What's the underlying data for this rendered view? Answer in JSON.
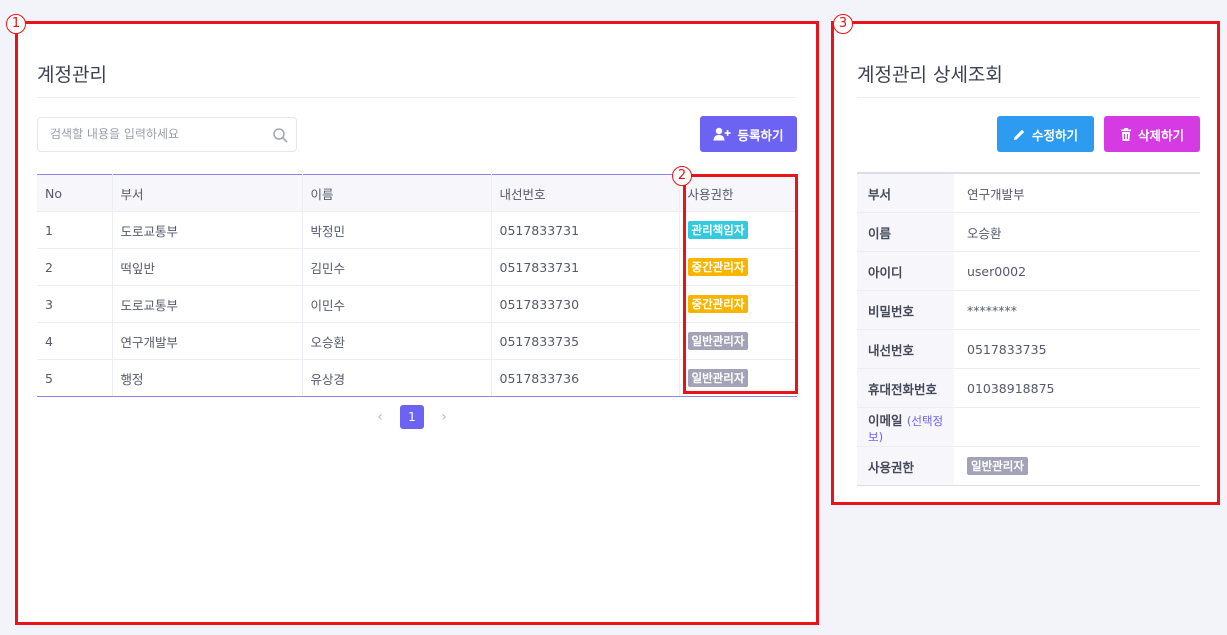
{
  "list_panel": {
    "title": "계정관리",
    "search": {
      "placeholder": "검색할 내용을 입력하세요"
    },
    "register_button": "등록하기",
    "columns": [
      "No",
      "부서",
      "이름",
      "내선번호",
      "사용권한"
    ],
    "rows": [
      {
        "no": "1",
        "dept": "도로교통부",
        "name": "박정민",
        "ext": "0517833731",
        "role": "관리책임자",
        "role_color": "#34c9dd"
      },
      {
        "no": "2",
        "dept": "떡잎반",
        "name": "김민수",
        "ext": "0517833731",
        "role": "중간관리자",
        "role_color": "#f7b500"
      },
      {
        "no": "3",
        "dept": "도로교통부",
        "name": "이민수",
        "ext": "0517833730",
        "role": "중간관리자",
        "role_color": "#f7b500"
      },
      {
        "no": "4",
        "dept": "연구개발부",
        "name": "오승환",
        "ext": "0517833735",
        "role": "일반관리자",
        "role_color": "#a3a3b8"
      },
      {
        "no": "5",
        "dept": "행정",
        "name": "유상경",
        "ext": "0517833736",
        "role": "일반관리자",
        "role_color": "#a3a3b8"
      }
    ],
    "pagination": {
      "prev": "‹",
      "current": "1",
      "next": "›"
    }
  },
  "detail_panel": {
    "title": "계정관리 상세조회",
    "edit_button": "수정하기",
    "delete_button": "삭제하기",
    "fields": [
      {
        "label": "부서",
        "value": "연구개발부"
      },
      {
        "label": "이름",
        "value": "오승환"
      },
      {
        "label": "아이디",
        "value": "user0002"
      },
      {
        "label": "비밀번호",
        "value": "********"
      },
      {
        "label": "내선번호",
        "value": "0517833735"
      },
      {
        "label": "휴대전화번호",
        "value": "01038918875"
      },
      {
        "label": "이메일",
        "hint": "(선택정보)",
        "value": ""
      },
      {
        "label": "사용권한",
        "value": "일반관리자"
      }
    ]
  },
  "annotations": {
    "marker_1": "1",
    "marker_2": "2",
    "marker_3": "3"
  },
  "colors": {
    "accent": "#6c63f2",
    "edit": "#2d9bf0",
    "delete": "#d63ae3",
    "annotation_red": "#e8141b"
  }
}
